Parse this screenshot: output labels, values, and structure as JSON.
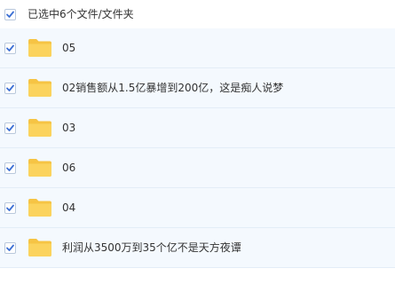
{
  "header": {
    "selection_text": "已选中6个文件/文件夹",
    "checked": true
  },
  "colors": {
    "check_mark": "#3b6fd4",
    "folder": "#fbd35d",
    "folder_tab": "#f6c444",
    "row_bg": "#f4f9fe"
  },
  "items": [
    {
      "name": "05",
      "type": "folder",
      "checked": true
    },
    {
      "name": "02销售额从1.5亿暴增到200亿，这是痴人说梦",
      "type": "folder",
      "checked": true
    },
    {
      "name": "03",
      "type": "folder",
      "checked": true
    },
    {
      "name": "06",
      "type": "folder",
      "checked": true
    },
    {
      "name": "04",
      "type": "folder",
      "checked": true
    },
    {
      "name": "利润从3500万到35个亿不是天方夜谭",
      "type": "folder",
      "checked": true
    }
  ]
}
